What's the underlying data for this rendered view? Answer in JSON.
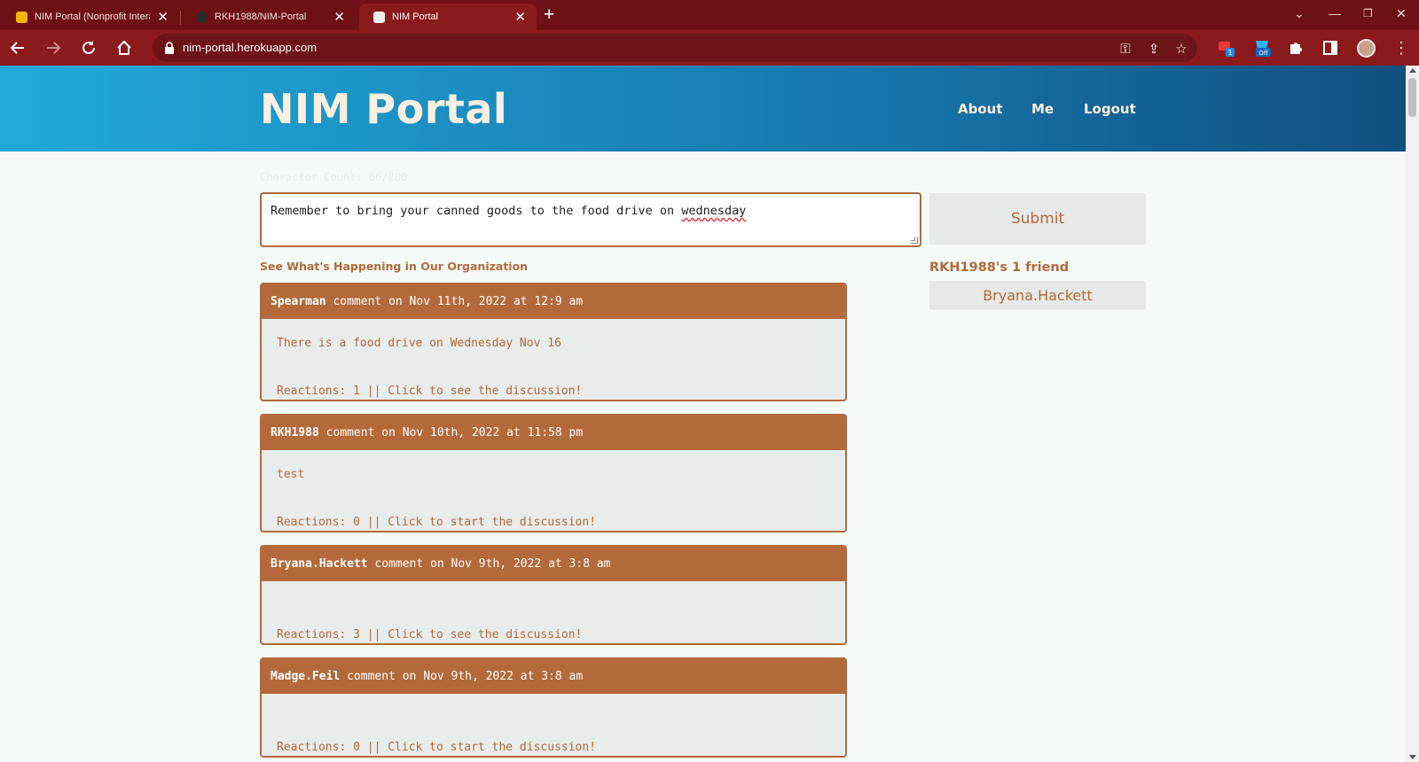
{
  "browser": {
    "tabs": [
      {
        "title": "NIM Portal (Nonprofit Interacti",
        "favicon_color": "#f4b400",
        "active": false
      },
      {
        "title": "RKH1988/NIM-Portal",
        "favicon_color": "#333333",
        "active": false
      },
      {
        "title": "NIM Portal",
        "favicon_color": "#e6e6e6",
        "active": true
      }
    ],
    "url": "nim-portal.herokuapp.com",
    "extension_badges": {
      "badge_one": "1",
      "badge_off": "Off"
    }
  },
  "site": {
    "brand": "NIM Portal",
    "nav": [
      "About",
      "Me",
      "Logout"
    ]
  },
  "composer": {
    "char_count": "Character Count: 66/280",
    "text_before": "Remember to bring your canned goods to the food drive on ",
    "text_misspelled": "wednesday",
    "submit_label": "Submit"
  },
  "feed": {
    "title": "See What's Happening in Our Organization",
    "posts": [
      {
        "author": "Spearman",
        "meta": " comment on Nov 11th, 2022 at 12:9 am",
        "text": "There is a food drive on Wednesday Nov 16",
        "reactions": "Reactions: 1 || Click to see the discussion!"
      },
      {
        "author": "RKH1988",
        "meta": " comment on Nov 10th, 2022 at 11:58 pm",
        "text": "test",
        "reactions": "Reactions: 0 || Click to start the discussion!"
      },
      {
        "author": "Bryana.Hackett",
        "meta": " comment on Nov 9th, 2022 at 3:8 am",
        "text": "",
        "reactions": "Reactions: 3 || Click to see the discussion!"
      },
      {
        "author": "Madge.Feil",
        "meta": " comment on Nov 9th, 2022 at 3:8 am",
        "text": "",
        "reactions": "Reactions: 0 || Click to start the discussion!"
      }
    ]
  },
  "friends": {
    "title": "RKH1988's 1 friend",
    "list": [
      "Bryana.Hackett"
    ]
  },
  "colors": {
    "accent": "#b4693a",
    "header_gradient_start": "#22a9db",
    "header_gradient_end": "#104f7f",
    "browser_frame": "#8b1a1c"
  }
}
